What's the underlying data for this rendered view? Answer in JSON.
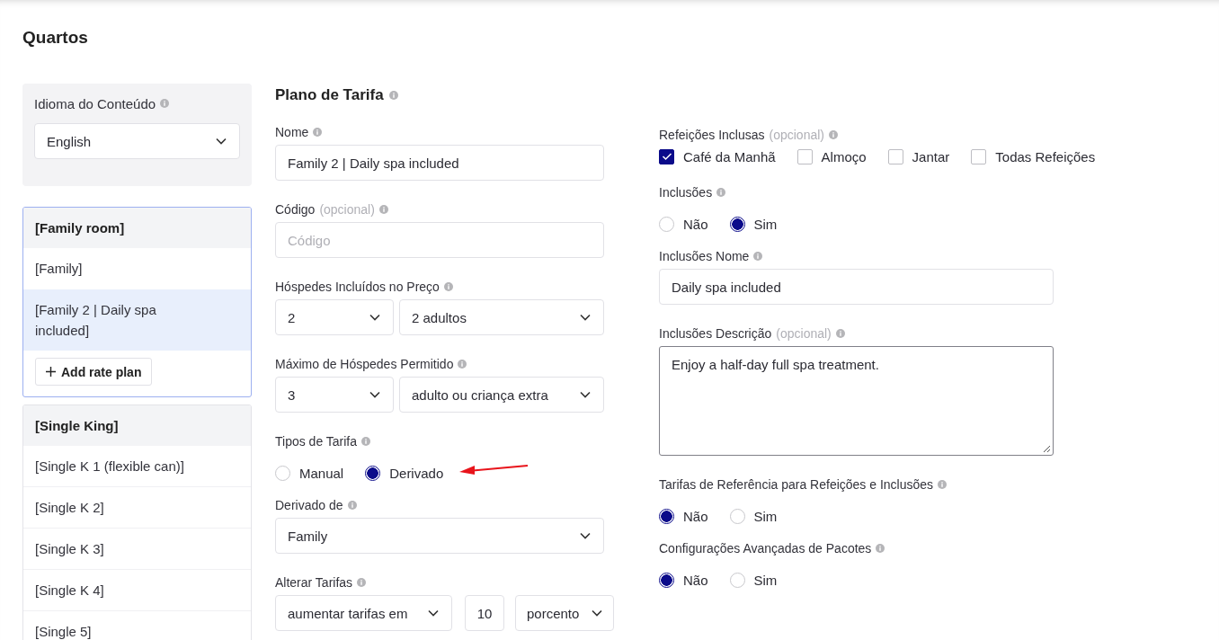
{
  "page": {
    "title": "Quartos"
  },
  "language_panel": {
    "label": "Idioma do Conteúdo",
    "value": "English"
  },
  "room_groups": [
    {
      "name": "[Family room]",
      "focused": true,
      "rate_plans": [
        {
          "name": "[Family]",
          "selected": false
        },
        {
          "name": "[Family 2 | Daily spa included]",
          "selected": true
        }
      ],
      "add_button": "Add rate plan"
    },
    {
      "name": "[Single King]",
      "focused": false,
      "rate_plans": [
        {
          "name": "[Single K 1 (flexible can)]",
          "selected": false
        },
        {
          "name": "[Single K 2]",
          "selected": false
        },
        {
          "name": "[Single K 3]",
          "selected": false
        },
        {
          "name": "[Single K 4]",
          "selected": false
        },
        {
          "name": "[Single 5]",
          "selected": false
        }
      ]
    }
  ],
  "rate_plan": {
    "title": "Plano de Tarifa",
    "left_fields": [
      {
        "kind": "text",
        "label": "Nome",
        "value": "Family 2 | Daily spa included"
      },
      {
        "kind": "text",
        "label": "Código",
        "optional": "(opcional)",
        "placeholder": "Código"
      },
      {
        "kind": "select_pair",
        "label": "Hóspedes Incluídos no Preço",
        "values": [
          "2",
          "2 adultos"
        ]
      },
      {
        "kind": "select_pair",
        "label": "Máximo de Hóspedes Permitido",
        "values": [
          "3",
          "adulto ou criança extra"
        ]
      },
      {
        "kind": "radio",
        "label": "Tipos de Tarifa",
        "annotated": true,
        "options": [
          {
            "label": "Manual",
            "selected": false
          },
          {
            "label": "Derivado",
            "selected": true
          }
        ]
      },
      {
        "kind": "select",
        "label": "Derivado de",
        "value": "Family"
      },
      {
        "kind": "adjust",
        "label": "Alterar Tarifas",
        "values": [
          "aumentar tarifas em",
          "10",
          "porcento"
        ]
      }
    ],
    "right_fields": [
      {
        "kind": "checkboxes",
        "label": "Refeições Inclusas",
        "optional": "(opcional)",
        "options": [
          {
            "label": "Café da Manhã",
            "checked": true
          },
          {
            "label": "Almoço",
            "checked": false
          },
          {
            "label": "Jantar",
            "checked": false
          },
          {
            "label": "Todas Refeições",
            "checked": false
          }
        ]
      },
      {
        "kind": "radio",
        "label": "Inclusões",
        "options": [
          {
            "label": "Não",
            "selected": false
          },
          {
            "label": "Sim",
            "selected": true
          }
        ]
      },
      {
        "kind": "text",
        "label": "Inclusões Nome",
        "value": "Daily spa included"
      },
      {
        "kind": "textarea",
        "label": "Inclusões Descrição",
        "optional": "(opcional)",
        "value": "Enjoy a half-day full spa treatment."
      },
      {
        "kind": "radio",
        "label": "Tarifas de Referência para Refeições e Inclusões",
        "options": [
          {
            "label": "Não",
            "selected": true
          },
          {
            "label": "Sim",
            "selected": false
          }
        ]
      },
      {
        "kind": "radio",
        "label": "Configurações Avançadas de Pacotes",
        "options": [
          {
            "label": "Não",
            "selected": true
          },
          {
            "label": "Sim",
            "selected": false
          }
        ]
      }
    ]
  }
}
